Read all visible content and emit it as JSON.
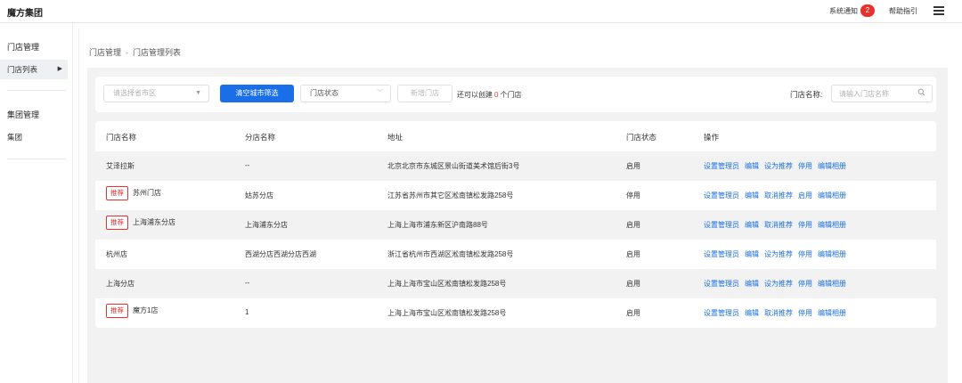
{
  "header": {
    "brand": "魔方集团",
    "notice_label": "系统通知",
    "notice_count": "2",
    "help_label": "帮助指引"
  },
  "sidebar": {
    "group1": "门店管理",
    "item_store_list": "门店列表",
    "group2": "集团管理",
    "item_group": "集团"
  },
  "breadcrumb": {
    "parent": "门店管理",
    "separator": "-",
    "current": "门店管理列表"
  },
  "filters": {
    "city_placeholder": "请选择省市区",
    "clear_button": "清空城市筛选",
    "status_placeholder": "门店状态",
    "add_button": "新增门店",
    "quota_prefix": "还可以创建",
    "quota_count": "0",
    "quota_suffix": "个门店",
    "name_label": "门店名称:",
    "name_placeholder": "请输入门店名称"
  },
  "table": {
    "headers": {
      "name": "门店名称",
      "branch": "分店名称",
      "address": "地址",
      "status": "门店状态",
      "actions": "操作"
    },
    "tag_label": "推荐",
    "rows": [
      {
        "tag": "",
        "name": "艾泽拉斯",
        "branch": "--",
        "address": "北京北京市东城区景山街道美术馆后街3号",
        "status": "启用",
        "actions": [
          "设置管理员",
          "编辑",
          "设为推荐",
          "停用",
          "编辑相册"
        ]
      },
      {
        "tag": "推荐",
        "name": "苏州门店",
        "branch": "姑苏分店",
        "address": "江苏省苏州市其它区淞南镇松发路258号",
        "status": "停用",
        "actions": [
          "设置管理员",
          "编辑",
          "取消推荐",
          "启用",
          "编辑相册"
        ]
      },
      {
        "tag": "推荐",
        "name": "上海浦东分店",
        "branch": "上海浦东分店",
        "address": "上海上海市浦东新区沪南路88号",
        "status": "启用",
        "actions": [
          "设置管理员",
          "编辑",
          "取消推荐",
          "停用",
          "编辑相册"
        ]
      },
      {
        "tag": "",
        "name": "杭州店",
        "branch": "西湖分店西湖分店西湖",
        "address": "浙江省杭州市西湖区淞南镇松发路258号",
        "status": "启用",
        "actions": [
          "设置管理员",
          "编辑",
          "设为推荐",
          "停用",
          "编辑相册"
        ]
      },
      {
        "tag": "",
        "name": "上海分店",
        "branch": "--",
        "address": "上海上海市宝山区淞南镇松发路258号",
        "status": "启用",
        "actions": [
          "设置管理员",
          "编辑",
          "设为推荐",
          "停用",
          "编辑相册"
        ]
      },
      {
        "tag": "推荐",
        "name": "魔方1店",
        "branch": "1",
        "address": "上海上海市宝山区淞南镇松发路258号",
        "status": "启用",
        "actions": [
          "设置管理员",
          "编辑",
          "取消推荐",
          "停用",
          "编辑相册"
        ]
      }
    ]
  },
  "colors": {
    "primary": "#1a6fe8",
    "danger": "#e8312f"
  }
}
